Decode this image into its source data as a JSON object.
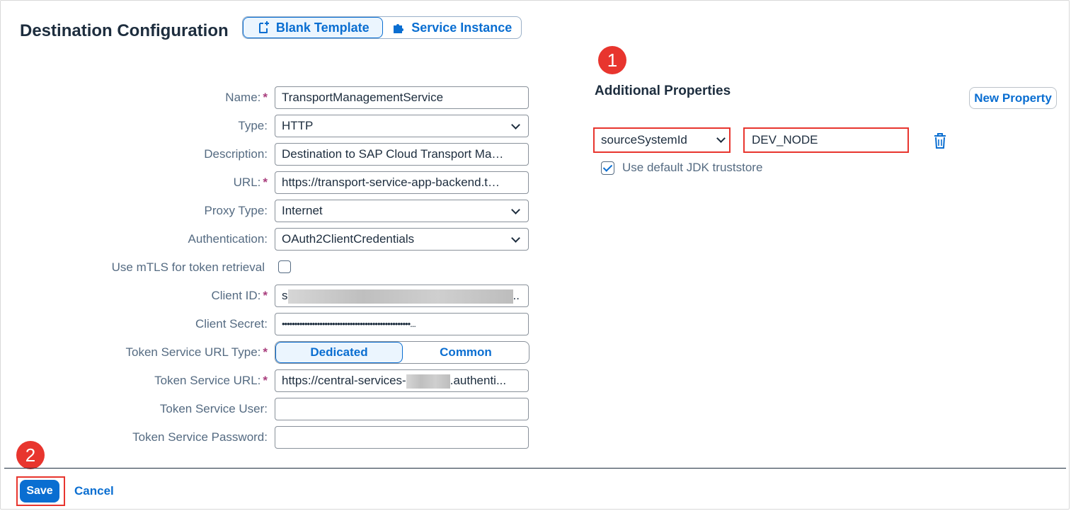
{
  "header": {
    "title": "Destination Configuration",
    "tabs": [
      {
        "label": "Blank Template",
        "selected": true
      },
      {
        "label": "Service Instance",
        "selected": false
      }
    ]
  },
  "form": {
    "name": {
      "label": "Name:",
      "value": "TransportManagementService",
      "required": true
    },
    "type": {
      "label": "Type:",
      "value": "HTTP"
    },
    "description": {
      "label": "Description:",
      "value": "Destination to SAP Cloud Transport Mana..."
    },
    "url": {
      "label": "URL:",
      "value": "https://transport-service-app-backend.ts.c...",
      "required": true
    },
    "proxy_type": {
      "label": "Proxy Type:",
      "value": "Internet"
    },
    "authentication": {
      "label": "Authentication:",
      "value": "OAuth2ClientCredentials"
    },
    "use_mtls": {
      "label": "Use mTLS for token retrieval",
      "checked": false
    },
    "client_id": {
      "label": "Client ID:",
      "prefix": "s",
      "suffix": "..",
      "required": true
    },
    "client_secret": {
      "label": "Client Secret:",
      "value": "•••••••••••••••••••••••••••••••••••••••••••••••••••..."
    },
    "token_service_url_type": {
      "label": "Token Service URL Type:",
      "options": [
        "Dedicated",
        "Common"
      ],
      "selected": "Dedicated",
      "required": true
    },
    "token_service_url": {
      "label": "Token Service URL:",
      "prefix": "https://central-services-",
      "suffix": ".authenti...",
      "required": true
    },
    "token_service_user": {
      "label": "Token Service User:",
      "value": ""
    },
    "token_service_password": {
      "label": "Token Service Password:",
      "value": ""
    }
  },
  "additional": {
    "title": "Additional Properties",
    "new_property_label": "New Property",
    "property_key": "sourceSystemId",
    "property_value": "DEV_NODE",
    "jdk_label": "Use default JDK truststore",
    "jdk_checked": true
  },
  "badges": {
    "one": "1",
    "two": "2"
  },
  "footer": {
    "save_label": "Save",
    "cancel_label": "Cancel"
  },
  "colors": {
    "accent": "#0a6ed1",
    "highlight": "#e8352e",
    "required": "#a93e7d"
  }
}
